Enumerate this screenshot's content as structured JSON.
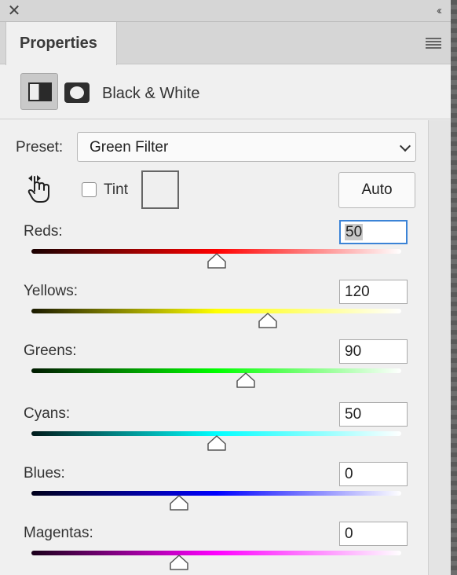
{
  "window": {
    "close_glyph": "✕",
    "collapse_glyph": "‹‹"
  },
  "tab": {
    "label": "Properties"
  },
  "header": {
    "adjustment_name": "Black & White"
  },
  "preset": {
    "label": "Preset:",
    "value": "Green Filter"
  },
  "tint": {
    "label": "Tint",
    "checked": false,
    "swatch_color": "#efefef"
  },
  "auto_button": {
    "label": "Auto"
  },
  "sliders": [
    {
      "label": "Reds:",
      "value": "50",
      "focused": true,
      "min": -200,
      "max": 300,
      "color": "#ff0000",
      "start": "#1a0000"
    },
    {
      "label": "Yellows:",
      "value": "120",
      "focused": false,
      "min": -200,
      "max": 300,
      "color": "#ffff00",
      "start": "#1a1a00"
    },
    {
      "label": "Greens:",
      "value": "90",
      "focused": false,
      "min": -200,
      "max": 300,
      "color": "#00ff00",
      "start": "#001a00"
    },
    {
      "label": "Cyans:",
      "value": "50",
      "focused": false,
      "min": -200,
      "max": 300,
      "color": "#00ffff",
      "start": "#001a1a"
    },
    {
      "label": "Blues:",
      "value": "0",
      "focused": false,
      "min": -200,
      "max": 300,
      "color": "#0000ff",
      "start": "#00001a"
    },
    {
      "label": "Magentas:",
      "value": "0",
      "focused": false,
      "min": -200,
      "max": 300,
      "color": "#ff00ff",
      "start": "#1a001a"
    }
  ]
}
